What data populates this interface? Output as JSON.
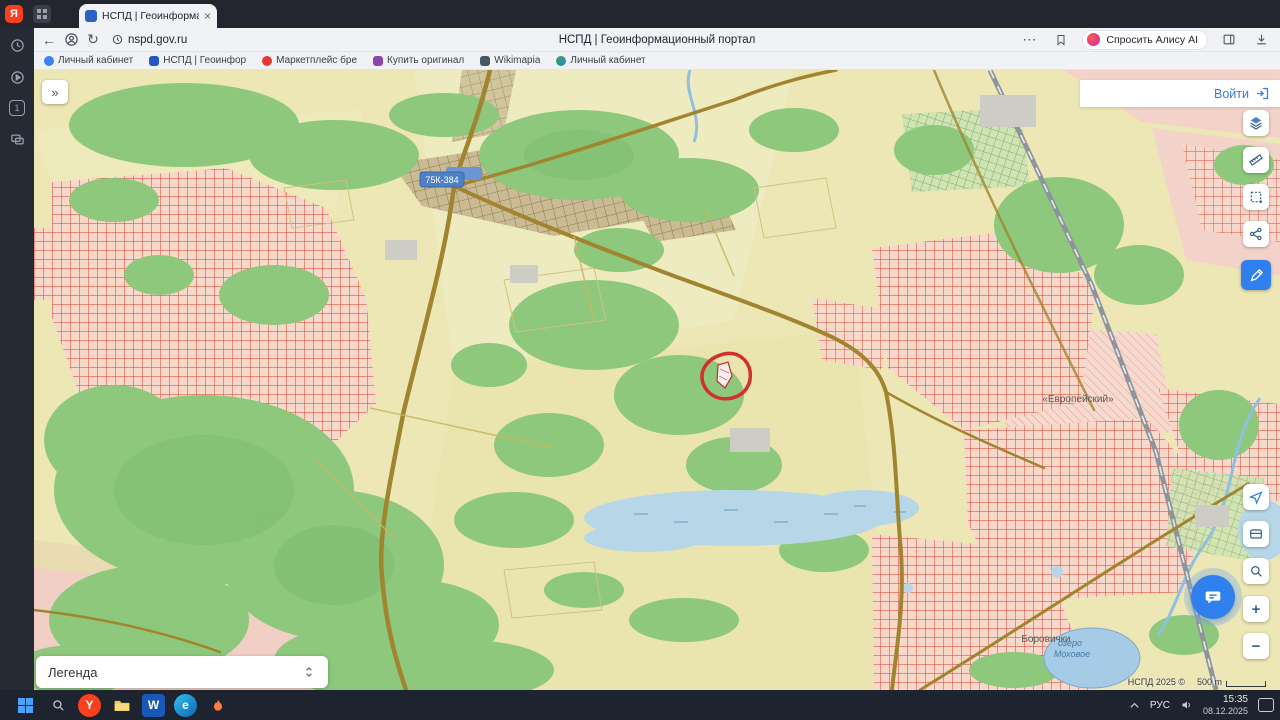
{
  "icons": {
    "close": "×",
    "back": "←",
    "reload": "↻",
    "more": "⋯",
    "chevron_right_double": "»"
  },
  "browser": {
    "logo_letter": "Я",
    "tab_title": "НСПД | Геоинформац",
    "url": "nspd.gov.ru",
    "page_title": "НСПД | Геоинформационный портал",
    "alice_label": "Спросить Алису AI",
    "bookmarks": [
      "Личный кабинет",
      "НСПД | Геоинфор",
      "Маркетплейс бре",
      "Купить оригинал",
      "Wikimapia",
      "Личный кабинет"
    ]
  },
  "sidebar": {
    "tab_count": "1"
  },
  "map": {
    "login_label": "Войти",
    "road_badge": "75К-384",
    "labels": {
      "estate": "«Европейский»",
      "village": "Боровички",
      "lake_line1": "озеро",
      "lake_line2": "Моховое"
    },
    "legend_label": "Легенда",
    "copyright": "НСПД 2025 ©",
    "scale_label": "500 m",
    "zoom_in": "+",
    "zoom_out": "−"
  },
  "taskbar": {
    "lang": "РУС",
    "time": "15:35",
    "date": "08.12.2025",
    "browser_letter": "Y",
    "word_letter": "W",
    "edge_letter": "e"
  }
}
